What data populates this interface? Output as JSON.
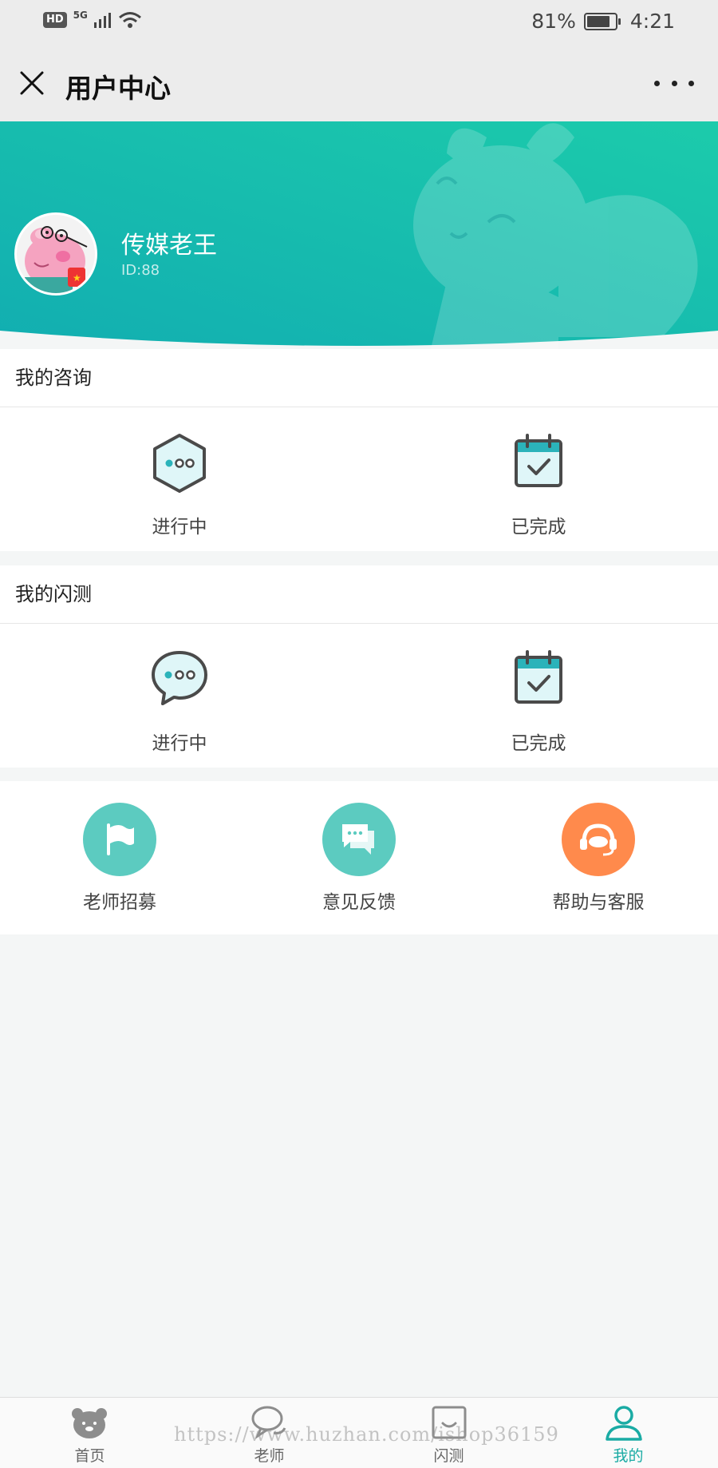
{
  "status_bar": {
    "hd": "HD",
    "network": "5G",
    "battery_percent": "81%",
    "battery_level": 0.81,
    "time": "4:21"
  },
  "header": {
    "title": "用户中心",
    "close_icon": "close-icon",
    "more_icon": "more-icon"
  },
  "profile": {
    "name": "传媒老王",
    "id_text": "ID:88",
    "banner_color_start": "#15b3b2",
    "banner_color_end": "#19c9ab"
  },
  "consult": {
    "title": "我的咨询",
    "items": [
      {
        "label": "进行中",
        "icon": "hexagon-chat-icon"
      },
      {
        "label": "已完成",
        "icon": "calendar-check-icon"
      }
    ]
  },
  "flash_test": {
    "title": "我的闪测",
    "items": [
      {
        "label": "进行中",
        "icon": "speech-bubble-icon"
      },
      {
        "label": "已完成",
        "icon": "calendar-check-icon"
      }
    ]
  },
  "quick_links": [
    {
      "label": "老师招募",
      "icon": "flag-icon",
      "color": "#5ccbc0"
    },
    {
      "label": "意见反馈",
      "icon": "feedback-icon",
      "color": "#5ccbc0"
    },
    {
      "label": "帮助与客服",
      "icon": "headset-icon",
      "color": "#ff8a4c"
    }
  ],
  "tab_bar": [
    {
      "label": "首页",
      "icon": "bear-icon",
      "active": false
    },
    {
      "label": "老师",
      "icon": "chat-icon",
      "active": false
    },
    {
      "label": "闪测",
      "icon": "smile-box-icon",
      "active": false
    },
    {
      "label": "我的",
      "icon": "user-icon",
      "active": true
    }
  ],
  "watermark": "https://www.huzhan.com/ishop36159",
  "colors": {
    "accent": "#1aaba4",
    "icon_fill": "#dff6f8",
    "icon_stroke": "#4a4a4a"
  }
}
